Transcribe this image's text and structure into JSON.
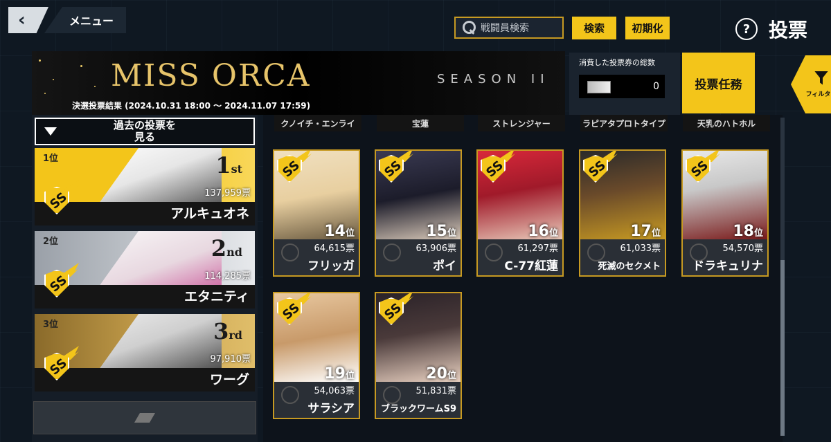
{
  "header": {
    "back_icon": "chevron-left-icon",
    "menu_label": "メニュー",
    "search_placeholder": "戦闘員検索",
    "search_button": "検索",
    "reset_button": "初期化",
    "help_icon": "question-icon",
    "title": "投票"
  },
  "banner": {
    "logo": "MISS ORCA",
    "season": "SEASON II",
    "subtitle": "決選投票結果 (2024.10.31 18:00 ～ 2024.11.07 17:59)",
    "accent_color": "#e7c46a"
  },
  "tickets": {
    "label": "消費した投票券の総数",
    "value": "0"
  },
  "mission_button": "投票任務",
  "filter": {
    "icon": "filter-icon",
    "label": "フィルター"
  },
  "past_votes_button": "過去の投票を\n見る",
  "top_ranks": [
    {
      "place": "1位",
      "ordinal_num": "1",
      "ordinal_suffix": "st",
      "votes": "137,959票",
      "name": "アルキュオネ",
      "bg": "#f3c51a"
    },
    {
      "place": "2位",
      "ordinal_num": "2",
      "ordinal_suffix": "nd",
      "votes": "114,285票",
      "name": "エタニティ",
      "bg": "#b9bec6"
    },
    {
      "place": "3位",
      "ordinal_num": "3",
      "ordinal_suffix": "rd",
      "votes": "97,910票",
      "name": "ワーグ",
      "bg": "#c9a24d"
    }
  ],
  "top_strip": [
    "クノイチ・エンライ",
    "宝蓮",
    "ストレンジャー",
    "ラピアタプロトタイプ",
    "天乳のハトホル"
  ],
  "characters": [
    {
      "rank_num": "14",
      "rank_suffix": "位",
      "votes": "64,615票",
      "name": "フリッガ"
    },
    {
      "rank_num": "15",
      "rank_suffix": "位",
      "votes": "63,906票",
      "name": "ポイ"
    },
    {
      "rank_num": "16",
      "rank_suffix": "位",
      "votes": "61,297票",
      "name": "C-77紅蓮"
    },
    {
      "rank_num": "17",
      "rank_suffix": "位",
      "votes": "61,033票",
      "name": "死滅のセクメト"
    },
    {
      "rank_num": "18",
      "rank_suffix": "位",
      "votes": "54,570票",
      "name": "ドラキュリナ"
    },
    {
      "rank_num": "19",
      "rank_suffix": "位",
      "votes": "54,063票",
      "name": "サラシア"
    },
    {
      "rank_num": "20",
      "rank_suffix": "位",
      "votes": "51,831票",
      "name": "ブラックワームS9"
    }
  ]
}
